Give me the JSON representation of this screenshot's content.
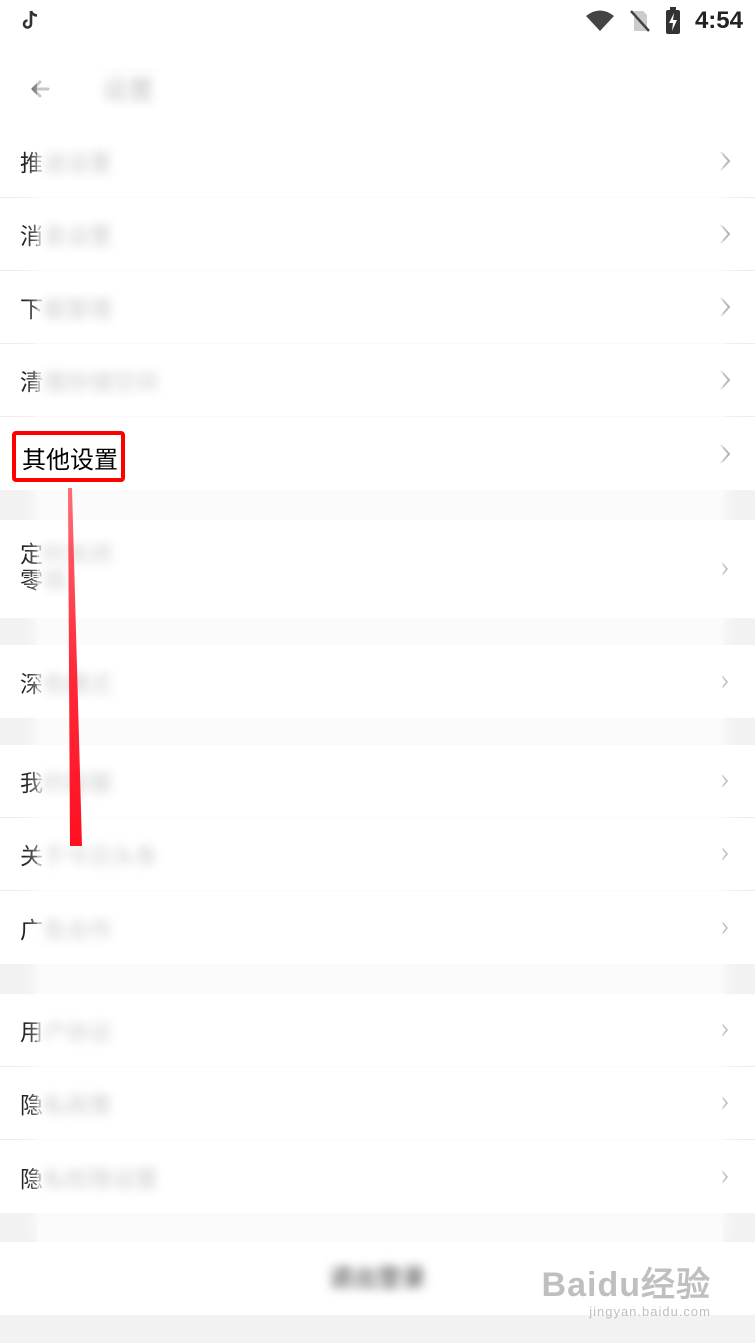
{
  "status_bar": {
    "time": "4:54",
    "app_icon": "tiktok-icon",
    "icons": [
      "wifi-icon",
      "no-sim-icon",
      "battery-charging-icon"
    ]
  },
  "header": {
    "back_icon": "back-arrow-icon",
    "title": "设置"
  },
  "sections": [
    {
      "rows": [
        {
          "prefix": "推",
          "rest": "送设置",
          "chevron": "chevron-right-icon"
        },
        {
          "prefix": "消",
          "rest": "息设置",
          "chevron": "chevron-right-icon"
        },
        {
          "prefix": "下",
          "rest": "载管理",
          "chevron": "chevron-right-icon"
        },
        {
          "prefix": "清",
          "rest": "理存储空间",
          "chevron": "chevron-right-icon"
        },
        {
          "prefix": "",
          "rest": "其他设置",
          "chevron": "chevron-right-icon"
        }
      ]
    },
    {
      "rows": [
        {
          "prefix": "定",
          "rest": "时关闭",
          "line2_prefix": "零",
          "line2_rest": "钱",
          "chevron": "chevron-right-icon"
        }
      ]
    },
    {
      "rows": [
        {
          "prefix": "深",
          "rest": "色模式",
          "chevron": "chevron-right-icon"
        }
      ]
    },
    {
      "rows": [
        {
          "prefix": "我",
          "rest": "的客服",
          "chevron": "chevron-right-icon"
        },
        {
          "prefix": "关",
          "rest": "于今日头条",
          "chevron": "chevron-right-icon"
        },
        {
          "prefix": "广",
          "rest": "告合作",
          "chevron": "chevron-right-icon"
        }
      ]
    },
    {
      "rows": [
        {
          "prefix": "用",
          "rest": "户协议",
          "chevron": "chevron-right-icon"
        },
        {
          "prefix": "隐",
          "rest": "私政策",
          "chevron": "chevron-right-icon"
        },
        {
          "prefix": "隐",
          "rest": "私权限设置",
          "chevron": "chevron-right-icon"
        }
      ]
    }
  ],
  "logout_label": "退出登录",
  "highlight": {
    "label": "其他设置",
    "color": "#ff0000"
  },
  "watermark": {
    "main": "Baidu经验",
    "sub": "jingyan.baidu.com"
  },
  "colors": {
    "background": "#f2f2f2",
    "row_background": "#ffffff",
    "annotation_red": "#ff0000"
  }
}
